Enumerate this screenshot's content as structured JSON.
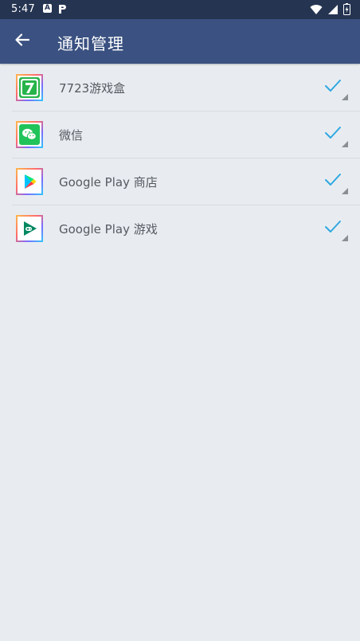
{
  "status_bar": {
    "time": "5:47",
    "left_icons": [
      "a-badge-icon",
      "p-badge-icon"
    ],
    "right_icons": [
      "wifi-icon",
      "signal-icon",
      "battery-icon"
    ]
  },
  "app_bar": {
    "title": "通知管理",
    "back_icon": "arrow-left-icon"
  },
  "apps": [
    {
      "name": "7723游戏盒",
      "icon": "app-7723-icon",
      "enabled": true
    },
    {
      "name": "微信",
      "icon": "wechat-icon",
      "enabled": true
    },
    {
      "name": "Google Play 商店",
      "icon": "google-play-store-icon",
      "enabled": true
    },
    {
      "name": "Google Play 游戏",
      "icon": "google-play-games-icon",
      "enabled": true
    }
  ],
  "colors": {
    "status_bar": "#253451",
    "app_bar": "#3a5181",
    "background": "#e8ecf1",
    "check": "#2fa8e0",
    "divider": "#d7dbe0"
  }
}
